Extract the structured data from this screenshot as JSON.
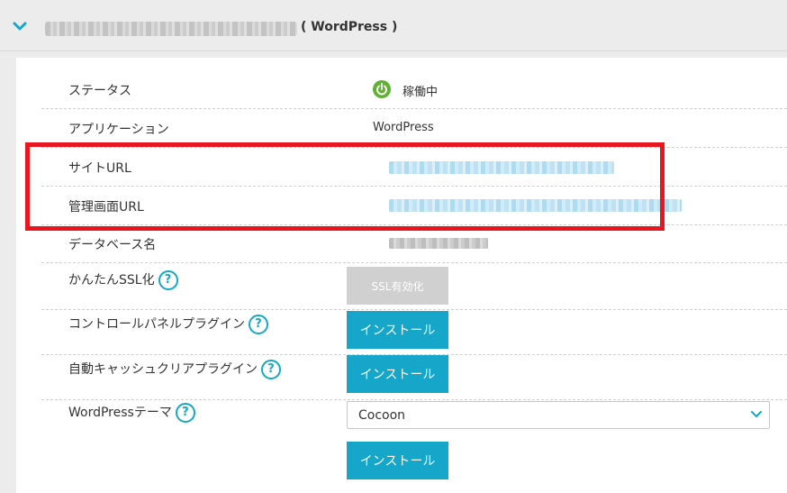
{
  "header": {
    "title": "( WordPress )",
    "url_blurred": true
  },
  "rows": {
    "status": {
      "label": "ステータス",
      "value": "稼働中"
    },
    "application": {
      "label": "アプリケーション",
      "value": "WordPress"
    },
    "site_url": {
      "label": "サイトURL"
    },
    "admin_url": {
      "label": "管理画面URL"
    },
    "database": {
      "label": "データベース名"
    },
    "ssl": {
      "label": "かんたんSSL化",
      "button": "SSL有効化"
    },
    "control_panel_plugin": {
      "label": "コントロールパネルプラグイン",
      "button": "インストール"
    },
    "cache_plugin": {
      "label": "自動キャッシュクリアプラグイン",
      "button": "インストール"
    },
    "theme": {
      "label": "WordPressテーマ",
      "selected": "Cocoon",
      "button": "インストール"
    }
  },
  "help_glyph": "?",
  "colors": {
    "accent": "#16a6c9",
    "status_green": "#5fb132",
    "highlight_red": "#e8161f"
  }
}
